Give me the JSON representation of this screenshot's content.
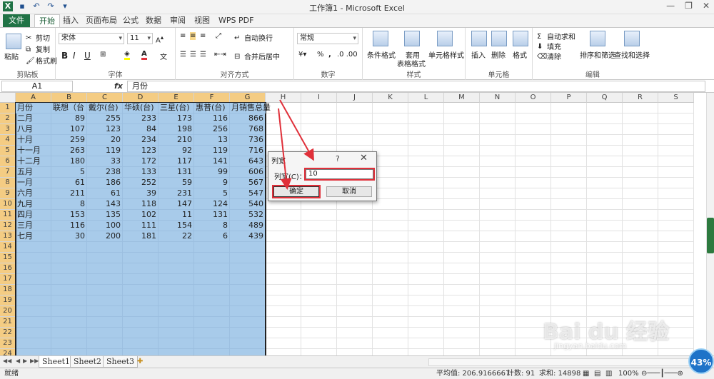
{
  "window": {
    "title": "工作簿1 - Microsoft Excel"
  },
  "tabs": [
    "文件",
    "开始",
    "插入",
    "页面布局",
    "公式",
    "数据",
    "审阅",
    "视图",
    "WPS PDF"
  ],
  "ribbon": {
    "clipboard": {
      "paste": "粘贴",
      "cut": "剪切",
      "copy": "复制",
      "format_painter": "格式刷",
      "label": "剪贴板"
    },
    "font": {
      "name": "宋体",
      "size": "11",
      "label": "字体",
      "bold": "B",
      "italic": "I",
      "underline": "U"
    },
    "alignment": {
      "wrap": "自动换行",
      "merge": "合并后居中",
      "label": "对齐方式"
    },
    "number": {
      "format": "常规",
      "percent": "%",
      "comma": ",",
      "label": "数字"
    },
    "styles": {
      "conditional": "条件格式",
      "table1": "套用",
      "table2": "表格格式",
      "cell_style": "单元格样式",
      "label": "样式"
    },
    "cells": {
      "insert": "插入",
      "delete": "删除",
      "format": "格式",
      "label": "单元格"
    },
    "editing": {
      "autosum": "自动求和",
      "fill": "填充",
      "clear": "清除",
      "sort": "排序和筛选",
      "find": "查找和选择",
      "label": "编辑"
    }
  },
  "formula_bar": {
    "name_box": "A1",
    "fx": "fx",
    "value": "月份"
  },
  "columns": [
    "A",
    "B",
    "C",
    "D",
    "E",
    "F",
    "G",
    "H",
    "I",
    "J",
    "K",
    "L",
    "M",
    "N",
    "O",
    "P",
    "Q",
    "R",
    "S"
  ],
  "headers": [
    "月份",
    "联想（台",
    "戴尔(台)",
    "华硕(台)",
    "三星(台)",
    "惠普(台)",
    "月销售总量"
  ],
  "rows": [
    [
      "二月",
      "89",
      "255",
      "233",
      "173",
      "116",
      "866"
    ],
    [
      "八月",
      "107",
      "123",
      "84",
      "198",
      "256",
      "768"
    ],
    [
      "十月",
      "259",
      "20",
      "234",
      "210",
      "13",
      "736"
    ],
    [
      "十一月",
      "263",
      "119",
      "123",
      "92",
      "119",
      "716"
    ],
    [
      "十二月",
      "180",
      "33",
      "172",
      "117",
      "141",
      "643"
    ],
    [
      "五月",
      "5",
      "238",
      "133",
      "131",
      "99",
      "606"
    ],
    [
      "一月",
      "61",
      "186",
      "252",
      "59",
      "9",
      "567"
    ],
    [
      "六月",
      "211",
      "61",
      "39",
      "231",
      "5",
      "547"
    ],
    [
      "九月",
      "8",
      "143",
      "118",
      "147",
      "124",
      "540"
    ],
    [
      "四月",
      "153",
      "135",
      "102",
      "11",
      "131",
      "532"
    ],
    [
      "三月",
      "116",
      "100",
      "111",
      "154",
      "8",
      "489"
    ],
    [
      "七月",
      "30",
      "200",
      "181",
      "22",
      "6",
      "439"
    ]
  ],
  "row_numbers": [
    "1",
    "2",
    "3",
    "4",
    "5",
    "6",
    "7",
    "8",
    "9",
    "10",
    "11",
    "12",
    "13",
    "14",
    "15",
    "16",
    "17",
    "18",
    "19",
    "20",
    "21",
    "22",
    "23",
    "24"
  ],
  "sheets": [
    "Sheet1",
    "Sheet2",
    "Sheet3"
  ],
  "status": {
    "ready": "就绪",
    "average": "平均值: 206.9166667",
    "count": "计数: 91",
    "sum": "求和: 14898",
    "zoom": "100%"
  },
  "dialog": {
    "title": "列宽",
    "help": "?",
    "close": "✕",
    "label": "列宽(C)：",
    "value": "10",
    "ok": "确定",
    "cancel": "取消"
  },
  "badge": "43%",
  "watermark": {
    "main": "Bai du 经验",
    "sub": "jingyan.baidu.com"
  },
  "colors": {
    "accent": "#217346",
    "selection": "#a8cbea",
    "header_selected": "#f4cc83",
    "annotation": "#e0303a"
  }
}
